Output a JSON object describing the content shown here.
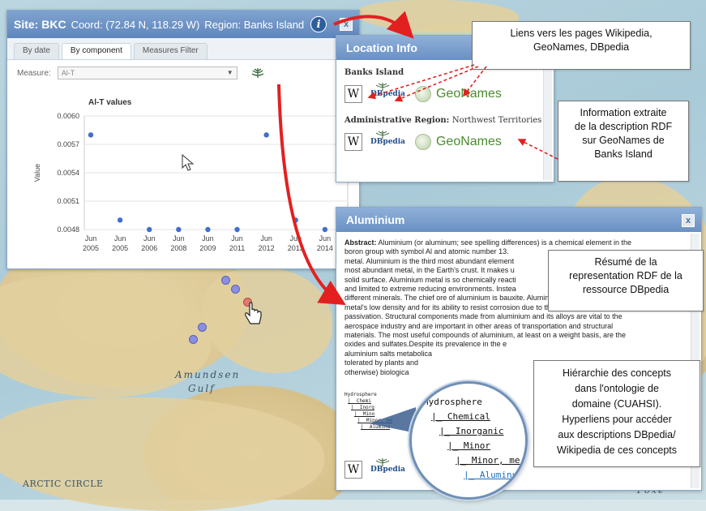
{
  "site_panel": {
    "title_site": "Site: BKC",
    "title_coord": "Coord: (72.84  N,  118.29 W)",
    "title_region": "Region: Banks Island",
    "info_icon": "i",
    "close": "x",
    "tabs": [
      "By date",
      "By component",
      "Measures Filter"
    ],
    "measure_label": "Measure:",
    "measure_value": "Al-T"
  },
  "chart_data": {
    "type": "scatter",
    "title": "Al-T values",
    "ylabel": "Value",
    "xlabel": "",
    "ylim": [
      0.0048,
      0.006
    ],
    "yticks": [
      "0.0060",
      "0.0057",
      "0.0054",
      "0.0051",
      "0.0048"
    ],
    "categories": [
      "Jun 2005",
      "Jun 2005",
      "Jun 2006",
      "Jun 2008",
      "Jun 2009",
      "Jun 2011",
      "Jun 2012",
      "Jun 2013",
      "Jun 2014"
    ],
    "points": [
      {
        "x": 0,
        "y": 0.0058
      },
      {
        "x": 1,
        "y": 0.0049
      },
      {
        "x": 2,
        "y": 0.0048
      },
      {
        "x": 3,
        "y": 0.0048
      },
      {
        "x": 4,
        "y": 0.0048
      },
      {
        "x": 5,
        "y": 0.0048
      },
      {
        "x": 6,
        "y": 0.0058
      },
      {
        "x": 7,
        "y": 0.0049
      },
      {
        "x": 8,
        "y": 0.0048
      }
    ],
    "grid": true,
    "color": "#3f6fd0"
  },
  "location_panel": {
    "title": "Location Info",
    "section1": "Banks Island",
    "section2_label": "Administrative Region:",
    "section2_value": "Northwest Territories",
    "wiki_label": "W",
    "dbpedia_label": "DBpedia",
    "geonames_label": "GeoNames"
  },
  "aluminium_panel": {
    "title": "Aluminium",
    "close": "x",
    "abstract_label": "Abstract:",
    "abstract_lines": [
      "Aluminium (or aluminum; see spelling differences) is a chemical element in the",
      "boron group with symbol Al and atomic number 13.",
      "metal. Aluminium is the third most abundant element",
      "most abundant metal, in the Earth's crust. It makes u",
      "solid surface. Aluminium metal is so chemically reacti",
      "and limited to extreme reducing environments. Instea",
      "different minerals. The chief ore of aluminium is bauxite. Aluminium is remarkable for the",
      "metal's low density and for its ability to resist corrosion due to the phenomenon of",
      "passivation. Structural components made from aluminium and its alloys are vital to the",
      "aerospace industry and are important in other areas of transportation and structural",
      "materials. The most useful compounds of aluminium, at least on a weight basis, are the",
      "oxides and sulfates.Despite its prevalence in the e",
      "aluminium salts metabolica",
      "tolerated by plants and",
      "otherwise) biologica"
    ],
    "hierarchy_small": [
      "Hydrosphere",
      "|_ Chemi",
      "|_ Inorg",
      "|_ Mino",
      "|_ Minor, me",
      "|_ Aluminu"
    ],
    "hierarchy_zoom": [
      "Hydrosphere",
      "|_ Chemical",
      "|_ Inorganic",
      "|_ Minor",
      "|_ Minor, me",
      "|_ Aluminum"
    ]
  },
  "callouts": {
    "links": [
      "Liens vers les pages Wikipedia,",
      "GeoNames, DBpedia"
    ],
    "geonames_info": [
      "Information extraite",
      "de la description RDF",
      "sur GeoNames de",
      "Banks Island"
    ],
    "dbpedia_summary": [
      "Résumé de la",
      "representation RDF de la",
      "ressource DBpedia"
    ],
    "hierarchy": [
      "Hiérarchie des concepts",
      "dans l'ontologie de",
      "domaine (CUAHSI).",
      "Hyperliens pour accéder",
      "aux descriptions DBpedia/",
      "Wikipedia de ces concepts"
    ]
  },
  "map": {
    "gulf_line1": "Amundsen",
    "gulf_line2": "Gulf",
    "arctic_circle": "ARCTIC CIRCLE",
    "foxe": "Foxe"
  }
}
